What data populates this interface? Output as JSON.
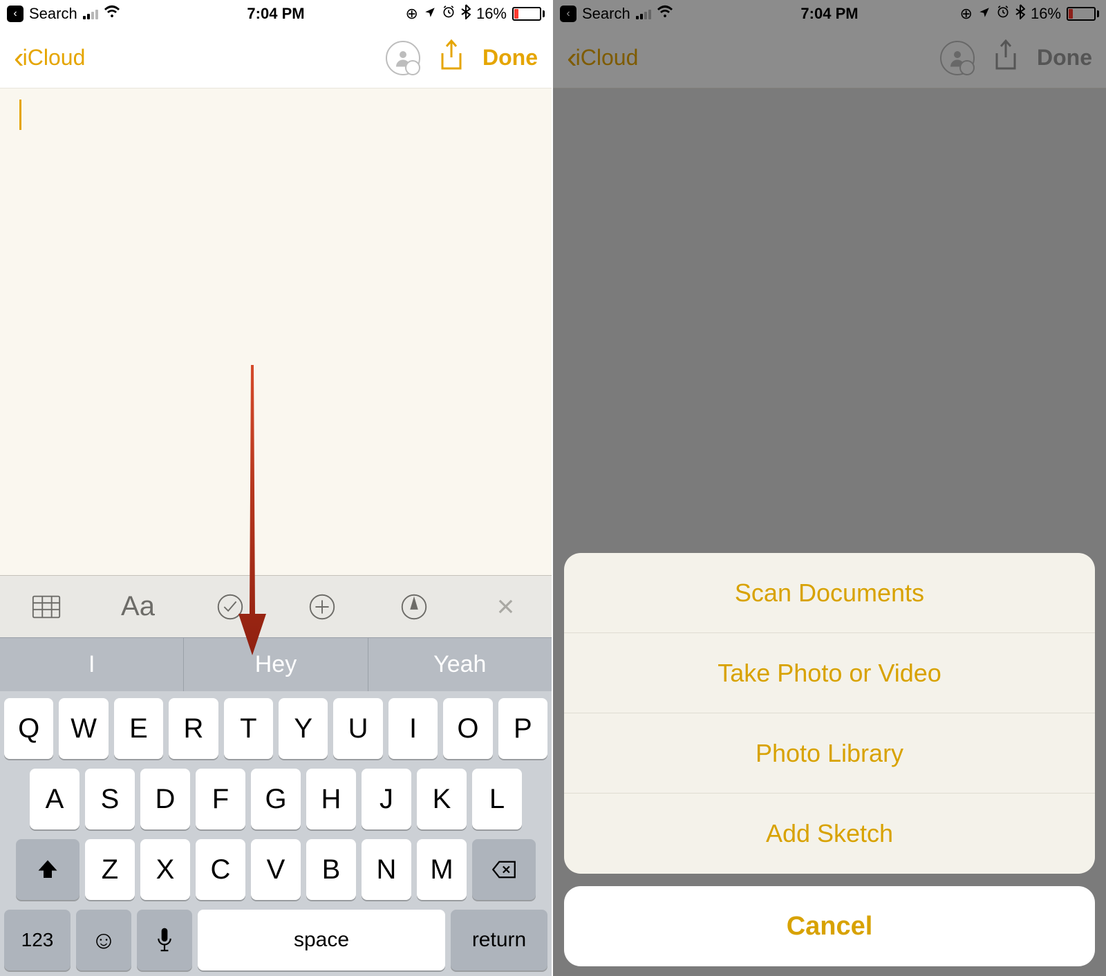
{
  "status": {
    "back_app": "Search",
    "time": "7:04 PM",
    "battery_pct": "16%"
  },
  "nav": {
    "back_label": "iCloud",
    "done_label": "Done"
  },
  "keyboard": {
    "suggestions": [
      "I",
      "Hey",
      "Yeah"
    ],
    "row1": [
      "Q",
      "W",
      "E",
      "R",
      "T",
      "Y",
      "U",
      "I",
      "O",
      "P"
    ],
    "row2": [
      "A",
      "S",
      "D",
      "F",
      "G",
      "H",
      "J",
      "K",
      "L"
    ],
    "row3": [
      "Z",
      "X",
      "C",
      "V",
      "B",
      "N",
      "M"
    ],
    "numkey": "123",
    "space": "space",
    "return": "return"
  },
  "actionsheet": {
    "options": [
      "Scan Documents",
      "Take Photo or Video",
      "Photo Library",
      "Add Sketch"
    ],
    "cancel": "Cancel"
  }
}
